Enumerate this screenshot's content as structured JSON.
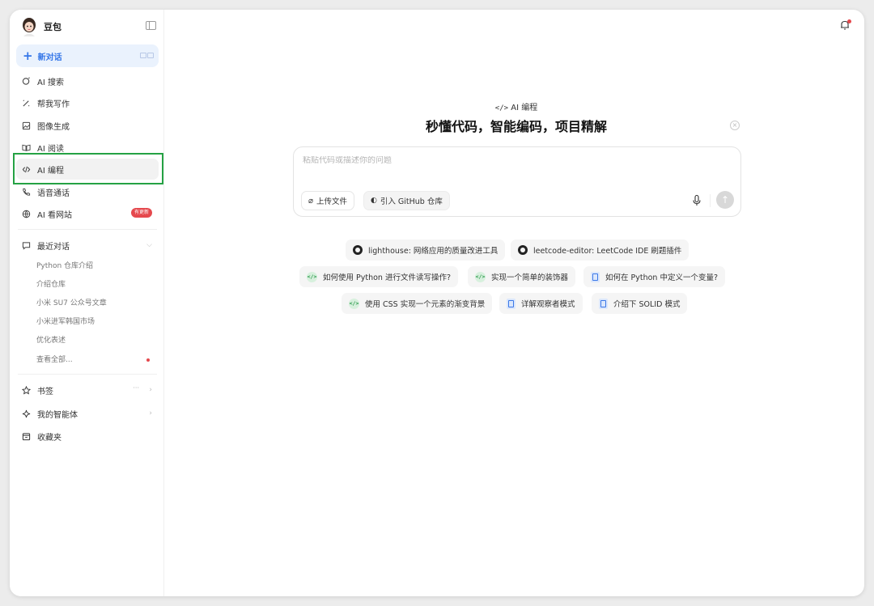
{
  "brand": {
    "name": "豆包"
  },
  "sidebar": {
    "new_chat_label": "新对话",
    "nav": [
      {
        "label": "AI 搜索",
        "icon": "search-icon"
      },
      {
        "label": "帮我写作",
        "icon": "pen-icon"
      },
      {
        "label": "图像生成",
        "icon": "image-icon"
      },
      {
        "label": "AI 阅读",
        "icon": "book-icon"
      },
      {
        "label": "AI 编程",
        "icon": "code-icon"
      },
      {
        "label": "语音通话",
        "icon": "phone-icon"
      },
      {
        "label": "AI 看网站",
        "icon": "globe-icon",
        "badge": "有更新"
      }
    ],
    "recent": {
      "title": "最近对话",
      "items": [
        "Python 仓库介绍",
        "介绍仓库",
        "小米 SU7 公众号文章",
        "小米进军韩国市场",
        "优化表述",
        "查看全部..."
      ]
    },
    "bookmarks_label": "书签",
    "agents_label": "我的智能体",
    "favorites_label": "收藏夹"
  },
  "main": {
    "mode_label": "AI 编程",
    "headline": "秒懂代码，智能编码，项目精解",
    "composer": {
      "placeholder": "粘贴代码或描述你的问题",
      "upload_label": "上传文件",
      "github_label": "引入 GitHub 仓库"
    },
    "suggestions": [
      {
        "text": "lighthouse: 网络应用的质量改进工具",
        "icon": "github-icon"
      },
      {
        "text": "leetcode-editor: LeetCode IDE 刷题插件",
        "icon": "github-icon"
      },
      {
        "text": "如何使用 Python 进行文件读写操作?",
        "icon": "code-icon"
      },
      {
        "text": "实现一个简单的装饰器",
        "icon": "code-icon"
      },
      {
        "text": "如何在 Python 中定义一个变量?",
        "icon": "document-icon"
      },
      {
        "text": "使用 CSS 实现一个元素的渐变背景",
        "icon": "code-icon"
      },
      {
        "text": "详解观察者模式",
        "icon": "document-icon"
      },
      {
        "text": "介绍下 SOLID 模式",
        "icon": "document-icon"
      }
    ]
  },
  "colors": {
    "accent": "#3476e8",
    "badge": "#e5484d",
    "highlight": "#25a244"
  }
}
